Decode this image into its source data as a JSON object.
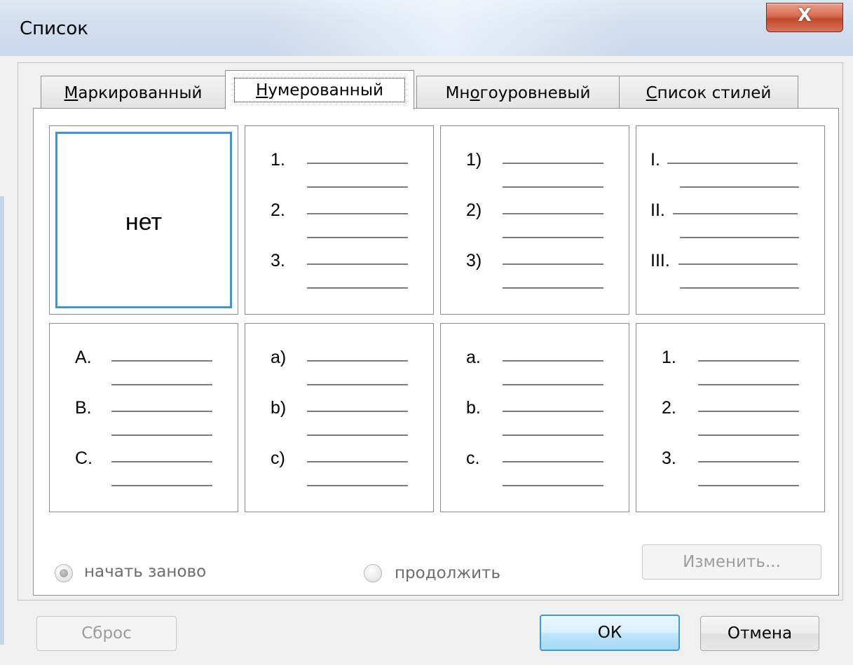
{
  "window": {
    "title": "Список",
    "close_symbol": "X"
  },
  "tabs": [
    {
      "label": "Маркированный",
      "mnemonic": "М",
      "rest": "аркированный",
      "active": false
    },
    {
      "label": "Нумерованный",
      "mnemonic": "Н",
      "rest": "умерованный",
      "active": true
    },
    {
      "label": "Многоуровневый",
      "pre": "Мн",
      "mnemonic": "о",
      "rest": "гоуровневый",
      "active": false
    },
    {
      "label": "Список стилей",
      "mnemonic": "С",
      "rest": "писок стилей",
      "active": false
    }
  ],
  "gallery": {
    "none_label": "нет",
    "styles": [
      {
        "id": "none"
      },
      {
        "id": "arabic-dot",
        "markers": [
          "1.",
          "2.",
          "3."
        ]
      },
      {
        "id": "arabic-paren",
        "markers": [
          "1)",
          "2)",
          "3)"
        ]
      },
      {
        "id": "roman-upper",
        "markers": [
          "I.",
          "II.",
          "III."
        ]
      },
      {
        "id": "alpha-upper",
        "markers": [
          "A.",
          "B.",
          "C."
        ]
      },
      {
        "id": "alpha-lower-paren",
        "markers": [
          "a)",
          "b)",
          "c)"
        ]
      },
      {
        "id": "alpha-lower-dot",
        "markers": [
          "a.",
          "b.",
          "c."
        ]
      },
      {
        "id": "arabic-dot-2",
        "markers": [
          "1.",
          "2.",
          "3."
        ]
      }
    ],
    "selected_index": 0
  },
  "options": {
    "restart_label": "начать заново",
    "restart_selected": true,
    "continue_label": "продолжить",
    "continue_selected": false,
    "customize_label": "Изменить..."
  },
  "footer": {
    "reset_label": "Сброс",
    "ok_label": "ОК",
    "cancel_label": "Отмена"
  }
}
